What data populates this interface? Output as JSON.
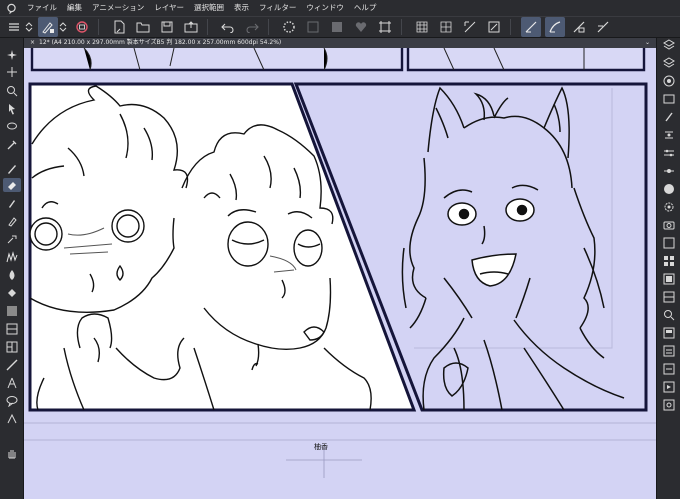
{
  "menu": {
    "items": [
      "ファイル",
      "編集",
      "アニメーション",
      "レイヤー",
      "選択範囲",
      "表示",
      "フィルター",
      "ウィンドウ",
      "ヘルプ"
    ]
  },
  "document": {
    "tab_title": "12* (A4 210.00 x 297.00mm 製本サイズB5 判 182.00 x 257.00mm 600dpi 54.2%)"
  },
  "canvas": {
    "caption": "柚香"
  },
  "colors": {
    "panel_bg": "#2b2c30",
    "canvas_bg": "#d3d3f4",
    "active_tool": "#4d5a73",
    "main_color": "#3a2016",
    "sub_color": "#f2f2f2"
  },
  "icons": {
    "toolbar": [
      "clip-studio-logo",
      "hamburger-menu-icon",
      "stepper-icon",
      "pen-pressure-icon",
      "zoom-icon",
      "new-file-icon",
      "open-file-icon",
      "save-icon",
      "export-icon",
      "undo-icon",
      "redo-icon",
      "loading-spinner-icon",
      "clear-icon",
      "fill-icon",
      "transform-icon",
      "grid-icon",
      "ruler-snap-icon",
      "stabilizer-icon",
      "vector-eraser-icon",
      "snap-ruler-icon",
      "snap-perspective-icon",
      "snap-grid-icon"
    ]
  }
}
